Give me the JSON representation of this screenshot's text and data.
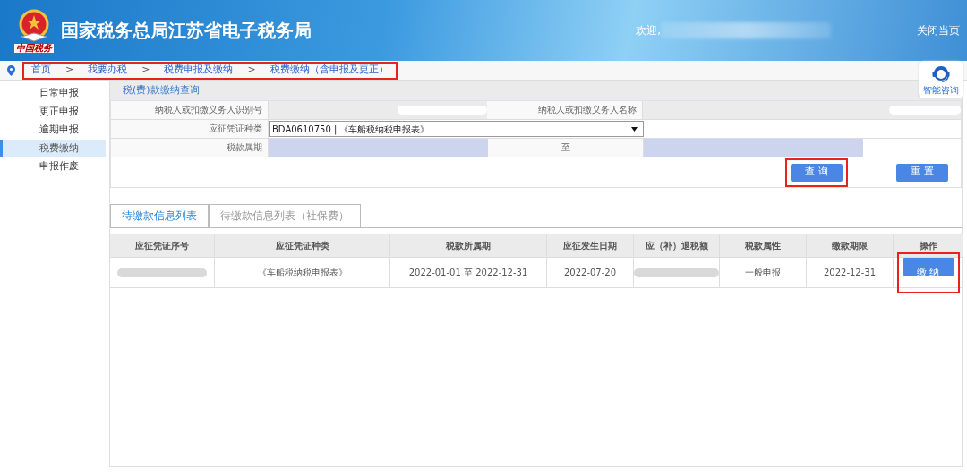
{
  "header": {
    "logo_text": "中国税务",
    "title": "国家税务总局江苏省电子税务局",
    "welcome": "欢迎,",
    "close_link": "关闭当页"
  },
  "breadcrumb": {
    "highlighted": true,
    "items": [
      "首页",
      "我要办税",
      "税费申报及缴纳",
      "税费缴纳（含申报及更正）"
    ],
    "separator": ">"
  },
  "assistant": {
    "label": "智能咨询"
  },
  "sidebar": {
    "items": [
      {
        "label": "日常申报",
        "selected": false
      },
      {
        "label": "更正申报",
        "selected": false
      },
      {
        "label": "逾期申报",
        "selected": false
      },
      {
        "label": "税费缴纳",
        "selected": true
      },
      {
        "label": "申报作废",
        "selected": false
      }
    ]
  },
  "query_panel": {
    "title": "税(费)款缴纳查询",
    "taxpayer_id_label": "纳税人或扣缴义务人识别号",
    "taxpayer_name_label": "纳税人或扣缴义务人名称",
    "voucher_type_label": "应征凭证种类",
    "voucher_type_value": "BDA0610750 | 《车船税纳税申报表》",
    "period_label": "税款属期",
    "period_to": "至",
    "buttons": [
      {
        "label": "查 询",
        "highlighted": true
      },
      {
        "label": "重 置",
        "highlighted": false
      }
    ]
  },
  "tabs": [
    {
      "label": "待缴款信息列表",
      "selected": true
    },
    {
      "label": "待缴款信息列表（社保费）",
      "selected": false
    }
  ],
  "table": {
    "columns": [
      "应征凭证序号",
      "应征凭证种类",
      "税款所属期",
      "应征发生日期",
      "应（补）退税额",
      "税款属性",
      "缴款期限",
      "操作"
    ],
    "rows": [
      {
        "cells": [
          null,
          "《车船税纳税申报表》",
          "2022-01-01 至 2022-12-31",
          "2022-07-20",
          null,
          "一般申报",
          "2022-12-31"
        ],
        "action": "缴 纳",
        "action_highlighted": true
      }
    ]
  }
}
